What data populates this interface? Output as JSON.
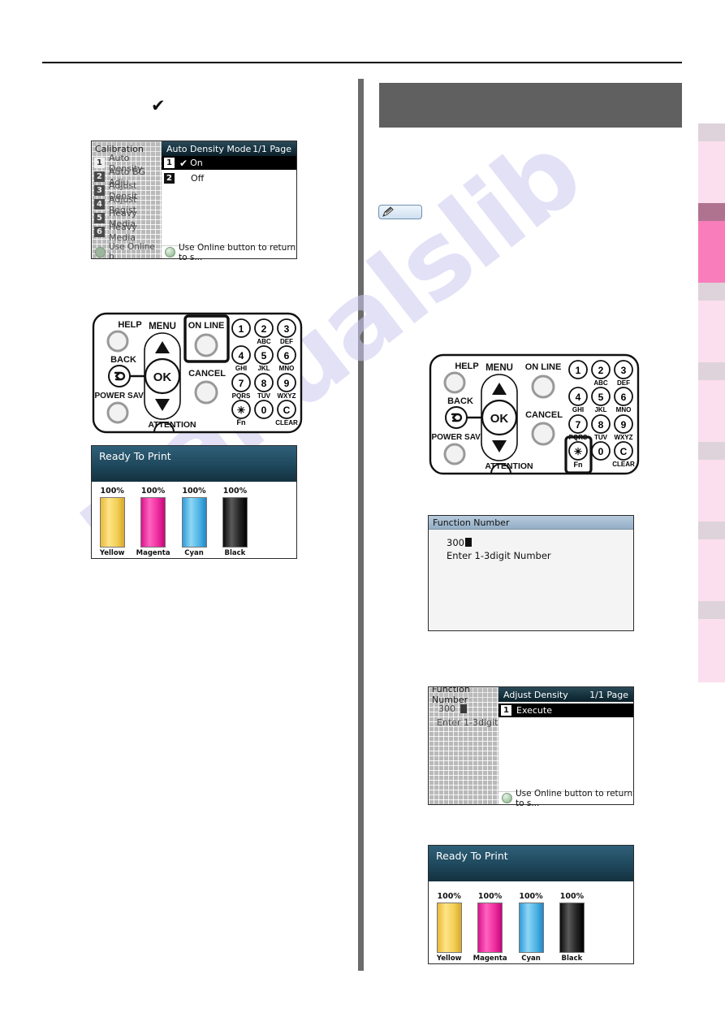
{
  "document": {
    "watermark": "manualslib"
  },
  "left_column": {
    "checkmark": "✔",
    "menu_screen": {
      "background_window": {
        "title": "Calibration",
        "items": [
          {
            "num": "1",
            "label": "Auto Density"
          },
          {
            "num": "2",
            "label": "Auto BG Adju"
          },
          {
            "num": "3",
            "label": "Adjust Densit"
          },
          {
            "num": "4",
            "label": "Adjust Regist"
          },
          {
            "num": "5",
            "label": "Heavy Media"
          },
          {
            "num": "6",
            "label": "Heavy Media"
          }
        ],
        "footer": "Use Online b"
      },
      "front_window": {
        "title": "Auto Density Mode",
        "page": "1/1 Page",
        "items": [
          {
            "num": "1",
            "label": "On",
            "selected": true,
            "check": "✔"
          },
          {
            "num": "2",
            "label": "Off",
            "selected": false,
            "check": ""
          }
        ],
        "footer": "Use Online button to return to s..."
      }
    },
    "operator_panel": {
      "highlight": "ON LINE",
      "labels": {
        "help": "HELP",
        "menu": "MENU",
        "online": "ON LINE",
        "back": "BACK",
        "ok": "OK",
        "cancel": "CANCEL",
        "power_save": "POWER SAVE",
        "attention": "ATTENTION",
        "fn": "Fn",
        "clear": "CLEAR"
      },
      "keypad": [
        {
          "digit": "1",
          "sub": ""
        },
        {
          "digit": "2",
          "sub": "ABC"
        },
        {
          "digit": "3",
          "sub": "DEF"
        },
        {
          "digit": "4",
          "sub": "GHI"
        },
        {
          "digit": "5",
          "sub": "JKL"
        },
        {
          "digit": "6",
          "sub": "MNO"
        },
        {
          "digit": "7",
          "sub": "PQRS"
        },
        {
          "digit": "8",
          "sub": "TUV"
        },
        {
          "digit": "9",
          "sub": "WXYZ"
        },
        {
          "digit": "✳",
          "sub": "Fn"
        },
        {
          "digit": "0",
          "sub": ""
        },
        {
          "digit": "C",
          "sub": "CLEAR"
        }
      ]
    },
    "ready_screen": {
      "status": "Ready To Print",
      "toners": [
        {
          "name": "Yellow",
          "percent": "100%",
          "color": "#f0c33c"
        },
        {
          "name": "Magenta",
          "percent": "100%",
          "color": "#e3199a"
        },
        {
          "name": "Cyan",
          "percent": "100%",
          "color": "#4fb4e5"
        },
        {
          "name": "Black",
          "percent": "100%",
          "color": "#1a1a1a"
        }
      ]
    }
  },
  "right_column": {
    "header_bar": {
      "text": ""
    },
    "memo_badge": {
      "icon": "pencil-icon"
    },
    "operator_panel": {
      "highlight": "Fn",
      "labels": {
        "help": "HELP",
        "menu": "MENU",
        "online": "ON LINE",
        "back": "BACK",
        "ok": "OK",
        "cancel": "CANCEL",
        "power_save": "POWER SAVE",
        "attention": "ATTENTION",
        "fn": "Fn",
        "clear": "CLEAR"
      },
      "keypad": [
        {
          "digit": "1",
          "sub": ""
        },
        {
          "digit": "2",
          "sub": "ABC"
        },
        {
          "digit": "3",
          "sub": "DEF"
        },
        {
          "digit": "4",
          "sub": "GHI"
        },
        {
          "digit": "5",
          "sub": "JKL"
        },
        {
          "digit": "6",
          "sub": "MNO"
        },
        {
          "digit": "7",
          "sub": "PQRS"
        },
        {
          "digit": "8",
          "sub": "TUV"
        },
        {
          "digit": "9",
          "sub": "WXYZ"
        },
        {
          "digit": "✳",
          "sub": "Fn"
        },
        {
          "digit": "0",
          "sub": ""
        },
        {
          "digit": "C",
          "sub": "CLEAR"
        }
      ]
    },
    "function_number_dialog": {
      "title": "Function Number",
      "value": "300",
      "hint": "Enter 1-3digit Number"
    },
    "adjust_density_screen": {
      "background_window": {
        "title": "Function Number",
        "value": "300",
        "hint": "Enter 1-3digit"
      },
      "front_window": {
        "title": "Adjust Density",
        "page": "1/1 Page",
        "items": [
          {
            "num": "1",
            "label": "Execute",
            "selected": true
          }
        ],
        "footer": "Use Online button to return to s..."
      }
    },
    "ready_screen": {
      "status": "Ready To Print",
      "toners": [
        {
          "name": "Yellow",
          "percent": "100%",
          "color": "#f0c33c"
        },
        {
          "name": "Magenta",
          "percent": "100%",
          "color": "#e3199a"
        },
        {
          "name": "Cyan",
          "percent": "100%",
          "color": "#4fb4e5"
        },
        {
          "name": "Black",
          "percent": "100%",
          "color": "#1a1a1a"
        }
      ]
    }
  },
  "side_tabs": [
    {
      "cap": "#ded3da",
      "body": "#fbdfee",
      "active": false
    },
    {
      "cap": "#b0738f",
      "body": "#f97cbb",
      "active": true
    },
    {
      "cap": "#ded3da",
      "body": "#fbdfee",
      "active": false
    },
    {
      "cap": "#ded3da",
      "body": "#fbdfee",
      "active": false
    },
    {
      "cap": "#ded3da",
      "body": "#fbdfee",
      "active": false
    },
    {
      "cap": "#ded3da",
      "body": "#fbdfee",
      "active": false
    },
    {
      "cap": "#ded3da",
      "body": "#fbdfee",
      "active": false
    }
  ]
}
